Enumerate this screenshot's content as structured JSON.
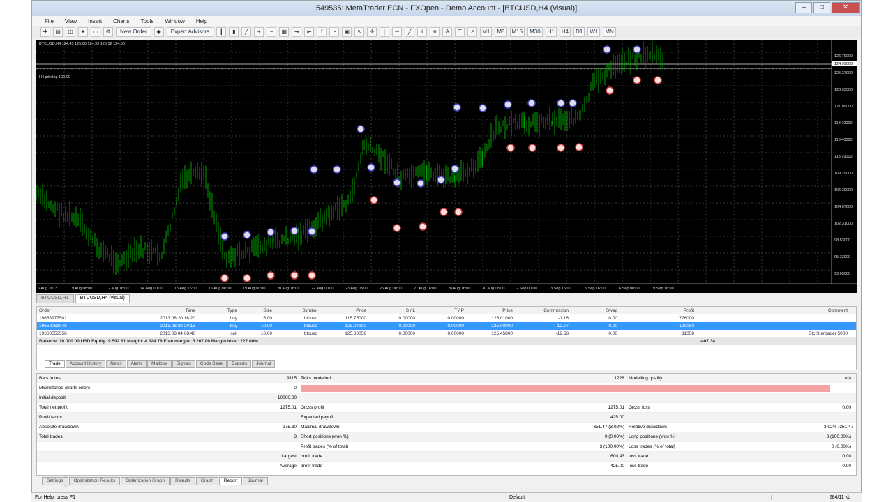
{
  "window": {
    "title": "549535: MetaTrader ECN - FXOpen - Demo Account - [BTCUSD,H4 (visual)]",
    "min": "–",
    "max": "□",
    "close": "✕"
  },
  "menu": [
    "File",
    "View",
    "Insert",
    "Charts",
    "Tools",
    "Window",
    "Help"
  ],
  "toolbar": {
    "new_order": "New Order",
    "expert_advisors": "Expert Advisors"
  },
  "chart": {
    "header": "BTCUSD,H4 124.45 125.00 124.99 125.32 124.80",
    "indicator_label": "H4 pd step 100.00",
    "price_labels": [
      "126.79000",
      "125.37000",
      "123.93000",
      "121.09000",
      "118.79000",
      "116.40000",
      "113.79000",
      "109.29000",
      "106.39000",
      "104.07000",
      "102.31000",
      "98.83000",
      "95.33000",
      "93.65000"
    ],
    "current_price": "124.99000",
    "time_labels": [
      "6 Aug 2013",
      "9 Aug 08:00",
      "12 Aug 16:00",
      "14 Aug 00:00",
      "15 Aug 16:00",
      "16 Aug 08:00",
      "19 Aug 00:00",
      "20 Aug 16:00",
      "22 Aug 00:00",
      "23 Aug 08:00",
      "26 Aug 00:00",
      "27 Aug 16:00",
      "28 Aug 16:00",
      "30 Aug 08:00",
      "2 Sep 00:00",
      "3 Sep 16:00",
      "5 Sep 16:00",
      "6 Sep 00:00",
      "9 Sep 16:00"
    ],
    "up_color": "#00a000",
    "buy_marker_color": "#4040c0",
    "sell_marker_color": "#c04040"
  },
  "chart_tabs": [
    "BTCUSD,H1",
    "BTCUSD,H4 (visual)"
  ],
  "terminal": {
    "headers": [
      "Order",
      "Time",
      "Type",
      "Size",
      "Symbol",
      "Price",
      "S / L",
      "T / P",
      "Price",
      "Commission",
      "Swap",
      "Profit",
      "Comment"
    ],
    "rows": [
      [
        "19658977501",
        "2013.08.20 16:20",
        "buy",
        "5.00",
        "btcusd",
        "115.75000",
        "0.00000",
        "0.00000",
        "125.01000",
        "-1.16",
        "0.00",
        "726000",
        ""
      ],
      [
        "19659061048",
        "2013.08.29 20:13",
        "buy",
        "10.00",
        "btcusd",
        "123.07900",
        "0.00000",
        "0.00000",
        "125.00000",
        "-12.77",
        "0.00",
        "190060",
        ""
      ],
      [
        "19660553558",
        "2013.08.04 08:40",
        "sell",
        "10.00",
        "btcusd",
        "125.80058",
        "0.00000",
        "0.00000",
        "125.45800",
        "-12.58",
        "0.00",
        "11358",
        "Btc Starbader 5000"
      ]
    ],
    "balance_line": "Balance: 10 000.00 USD  Equity: 9 592.61  Margin: 4 324.78  Free margin: 5 267.86  Margin level: 227.00%",
    "balance_profit": "-407.34"
  },
  "terminal_tabs": [
    "Trade",
    "Account History",
    "News",
    "Alerts",
    "Mailbox",
    "Signals",
    "Code Base",
    "Experts",
    "Journal"
  ],
  "report": {
    "rows": [
      [
        "Bars in test",
        "9115",
        "Ticks modelled",
        "1228",
        "Modelling quality",
        "n/a"
      ],
      [
        "Mismatched charts errors",
        "0",
        "",
        "",
        "",
        ""
      ],
      [
        "Initial deposit",
        "10000.00",
        "",
        "",
        "",
        ""
      ],
      [
        "Total net profit",
        "1275.01",
        "Gross profit",
        "1275.01",
        "Gross loss",
        "0.00"
      ],
      [
        "Profit factor",
        "",
        "Expected payoff",
        "425.00",
        "",
        ""
      ],
      [
        "Absolute drawdown",
        "275.30",
        "Maximal drawdown",
        "351.47 (3.02%)",
        "Relative drawdown",
        "3.02% (351.47)"
      ],
      [
        "Total trades",
        "3",
        "Short positions (won %)",
        "0 (0.00%)",
        "Long positions (won %)",
        "3 (100.00%)"
      ],
      [
        "",
        "",
        "Profit trades (% of total)",
        "3 (100.00%)",
        "Loss trades (% of total)",
        "0 (0.00%)"
      ],
      [
        "",
        "Largest",
        "profit trade",
        "600.43",
        "loss trade",
        "0.00"
      ],
      [
        "",
        "Average",
        "profit trade",
        "425.00",
        "loss trade",
        "0.00"
      ]
    ]
  },
  "strategy_tabs": [
    "Settings",
    "Optimization Results",
    "Optimization Graph",
    "Results",
    "Graph",
    "Report",
    "Journal"
  ],
  "status": {
    "help": "For Help, press F1",
    "profile": "Default",
    "traffic": "284/11 kb"
  }
}
